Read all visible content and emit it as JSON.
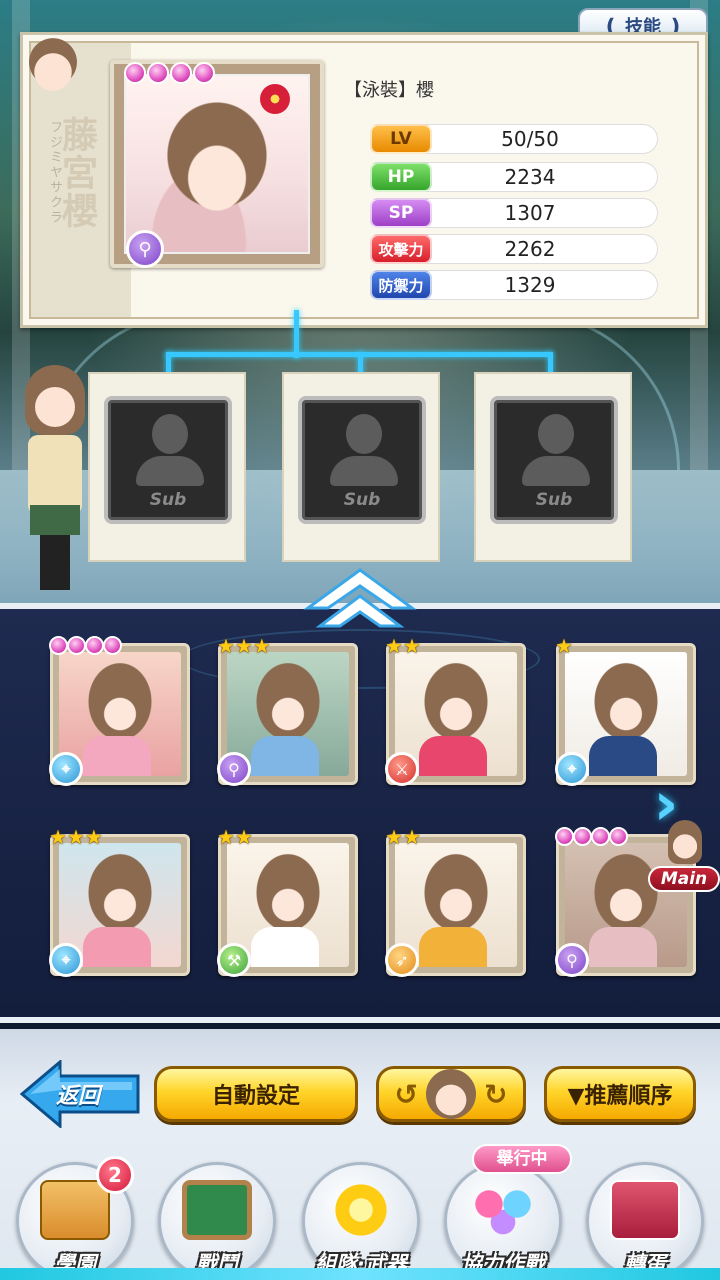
{
  "skill_button": {
    "label": "技能"
  },
  "character": {
    "name_kana": "フジミヤサクラ",
    "name_kanji": "藤宮櫻",
    "title": "【泳裝】櫻",
    "hearts": 4,
    "weapon_type": "wand",
    "stats": [
      {
        "label": "LV",
        "value": "50/50"
      },
      {
        "label": "HP",
        "value": "2234"
      },
      {
        "label": "SP",
        "value": "1307"
      },
      {
        "label": "攻擊力",
        "value": "2262"
      },
      {
        "label": "防禦力",
        "value": "1329"
      }
    ]
  },
  "sub_slots": [
    {
      "label": "Sub"
    },
    {
      "label": "Sub"
    },
    {
      "label": "Sub"
    }
  ],
  "roster": [
    {
      "rarity": "hearts",
      "count": 4,
      "weapon": "gun"
    },
    {
      "rarity": "stars",
      "count": 3,
      "weapon": "wand"
    },
    {
      "rarity": "stars",
      "count": 2,
      "weapon": "sword"
    },
    {
      "rarity": "stars",
      "count": 1,
      "weapon": "gun"
    },
    {
      "rarity": "stars",
      "count": 3,
      "weapon": "gun"
    },
    {
      "rarity": "stars",
      "count": 2,
      "weapon": "hammer"
    },
    {
      "rarity": "stars",
      "count": 2,
      "weapon": "spear"
    },
    {
      "rarity": "hearts",
      "count": 4,
      "weapon": "wand",
      "is_main": true
    }
  ],
  "main_tag": "Main",
  "actions": {
    "back": "返回",
    "auto_set": "自動設定",
    "sort": "▼推薦順序"
  },
  "nav": [
    {
      "label": "學園",
      "badge": "2"
    },
    {
      "label": "戰鬥"
    },
    {
      "label": "組隊·武器"
    },
    {
      "label": "協力作戰",
      "tag": "舉行中"
    },
    {
      "label": "轉蛋"
    }
  ]
}
